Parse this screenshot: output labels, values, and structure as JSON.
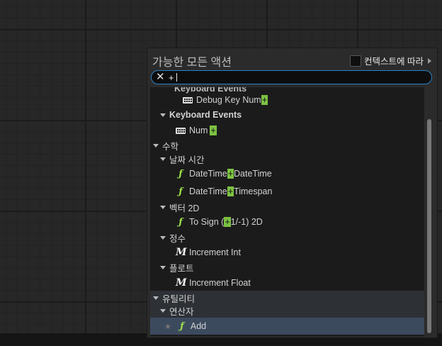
{
  "panel": {
    "title": "가능한 모든 액션",
    "context_label": "컨텍스트에 따라"
  },
  "search": {
    "value": "+"
  },
  "list": {
    "partial_category": "Keyboard Events",
    "debug_key": {
      "pre": "Debug Key Num",
      "match": "+",
      "post": ""
    },
    "keyboard_events": "Keyboard Events",
    "num": {
      "pre": "Num",
      "match": "+",
      "post": ""
    },
    "math": "수학",
    "datetime": "날짜 시간",
    "dt_dt": {
      "pre": "DateTime",
      "match": "+",
      "post": "DateTime"
    },
    "dt_ts": {
      "pre": "DateTime",
      "match": "+",
      "post": "Timespan"
    },
    "vector2d": "벡터 2D",
    "to_sign": {
      "pre": "To Sign (",
      "match": "+",
      "post": "1/-1) 2D"
    },
    "integer": "정수",
    "increment_int": "Increment Int",
    "float": "플로트",
    "increment_float": "Increment Float",
    "utilities": "유틸리티",
    "operators": "연산자",
    "add": "Add"
  },
  "icons": {
    "function": "function-icon",
    "macro": "macro-icon",
    "keyboard": "keyboard-icon",
    "favorite": "star-icon"
  },
  "colors": {
    "search_border": "#2a83c8",
    "match_highlight": "#7cc242",
    "function_icon": "#9fe24a",
    "selected_row": "#3c4a5e"
  }
}
